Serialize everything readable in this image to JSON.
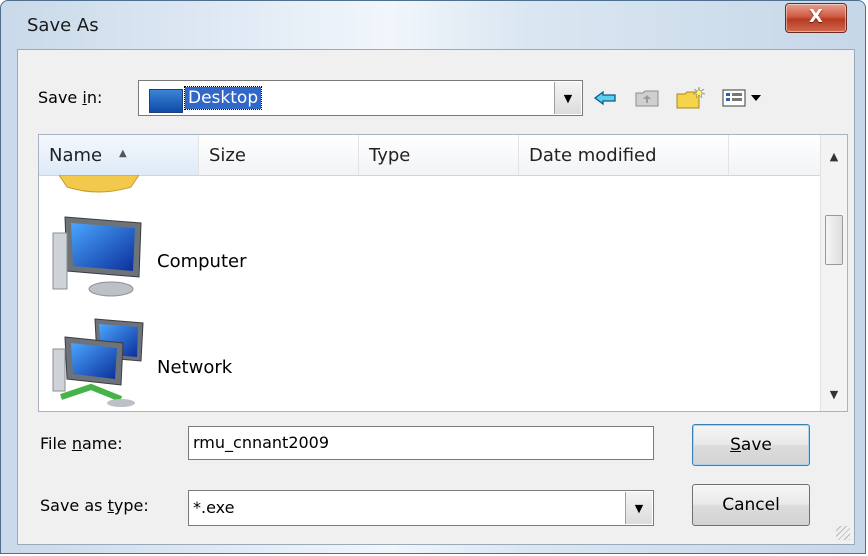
{
  "window": {
    "title": "Save As",
    "close_glyph": "X"
  },
  "save_in": {
    "label_prefix": "Save ",
    "label_underlined": "i",
    "label_suffix": "n:",
    "value": "Desktop",
    "icon": "desktop-icon"
  },
  "toolbar": {
    "back_icon": "back-arrow-icon",
    "up_icon": "up-folder-icon",
    "new_folder_icon": "new-folder-icon",
    "views_icon": "views-menu-icon"
  },
  "columns": [
    "Name",
    "Size",
    "Type",
    "Date modified"
  ],
  "items": [
    {
      "label": "Computer",
      "icon": "computer-icon"
    },
    {
      "label": "Network",
      "icon": "network-icon"
    }
  ],
  "file_name": {
    "label_prefix": "File ",
    "label_underlined": "n",
    "label_suffix": "ame:",
    "value": "rmu_cnnant2009"
  },
  "save_as_type": {
    "label_prefix": "Save as ",
    "label_underlined": "t",
    "label_suffix": "ype:",
    "value": "*.exe"
  },
  "buttons": {
    "save": {
      "label_underlined": "S",
      "label_rest": "ave"
    },
    "cancel": "Cancel"
  },
  "colors": {
    "selection": "#3168c8",
    "close_button": "#c9432c"
  }
}
